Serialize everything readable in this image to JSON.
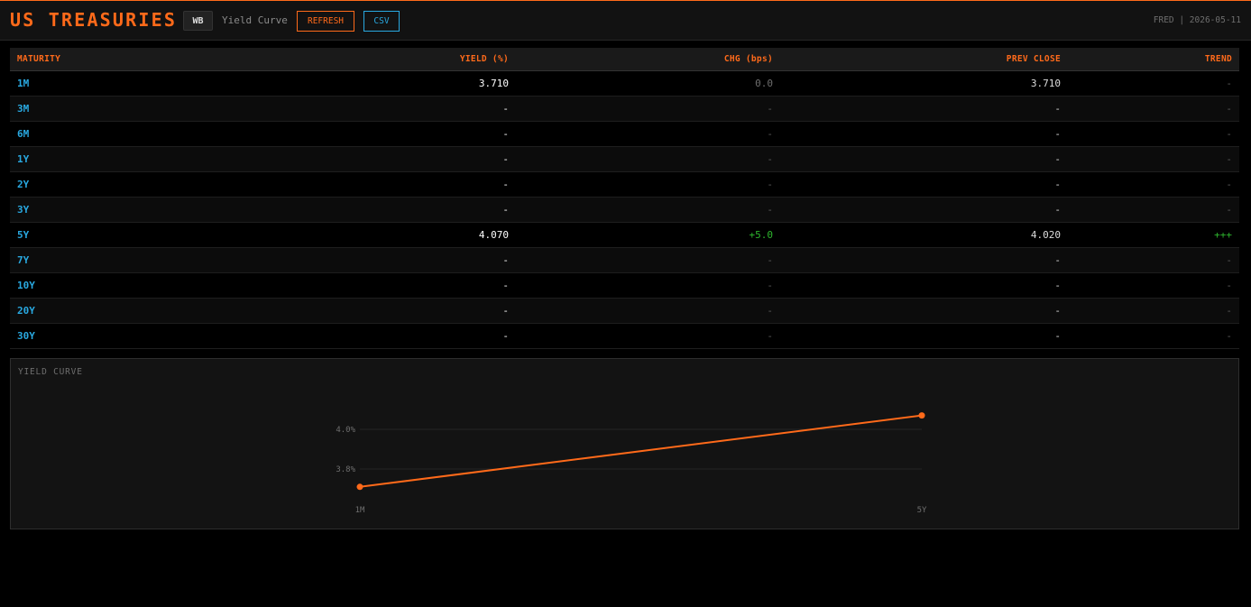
{
  "header": {
    "title": "US TREASURIES",
    "badge": "WB",
    "subtitle": "Yield Curve",
    "refresh_label": "REFRESH",
    "csv_label": "CSV",
    "source": "FRED | 2026-05-11"
  },
  "table": {
    "columns": [
      "MATURITY",
      "YIELD (%)",
      "CHG (bps)",
      "PREV CLOSE",
      "TREND"
    ],
    "rows": [
      {
        "maturity": "1M",
        "yield": "3.710",
        "chg": "0.0",
        "prev": "3.710",
        "trend": "-"
      },
      {
        "maturity": "3M",
        "yield": "-",
        "chg": "-",
        "prev": "-",
        "trend": "-"
      },
      {
        "maturity": "6M",
        "yield": "-",
        "chg": "-",
        "prev": "-",
        "trend": "-"
      },
      {
        "maturity": "1Y",
        "yield": "-",
        "chg": "-",
        "prev": "-",
        "trend": "-"
      },
      {
        "maturity": "2Y",
        "yield": "-",
        "chg": "-",
        "prev": "-",
        "trend": "-"
      },
      {
        "maturity": "3Y",
        "yield": "-",
        "chg": "-",
        "prev": "-",
        "trend": "-"
      },
      {
        "maturity": "5Y",
        "yield": "4.070",
        "chg": "+5.0",
        "prev": "4.020",
        "trend": "+++"
      },
      {
        "maturity": "7Y",
        "yield": "-",
        "chg": "-",
        "prev": "-",
        "trend": "-"
      },
      {
        "maturity": "10Y",
        "yield": "-",
        "chg": "-",
        "prev": "-",
        "trend": "-"
      },
      {
        "maturity": "20Y",
        "yield": "-",
        "chg": "-",
        "prev": "-",
        "trend": "-"
      },
      {
        "maturity": "30Y",
        "yield": "-",
        "chg": "-",
        "prev": "-",
        "trend": "-"
      }
    ]
  },
  "colors": {
    "accent": "#ff6a1a",
    "link": "#29a8e0",
    "positive": "#2db52d",
    "muted": "#5a5a5a"
  },
  "chart_data": {
    "type": "line",
    "title": "YIELD CURVE",
    "categories": [
      "1M",
      "5Y"
    ],
    "series": [
      {
        "values": [
          3.71,
          4.07
        ]
      }
    ],
    "yticks": [
      3.8,
      4.0
    ],
    "ytick_labels": [
      "3.8%",
      "4.0%"
    ],
    "grid": true,
    "xlabel": "",
    "ylabel": ""
  }
}
